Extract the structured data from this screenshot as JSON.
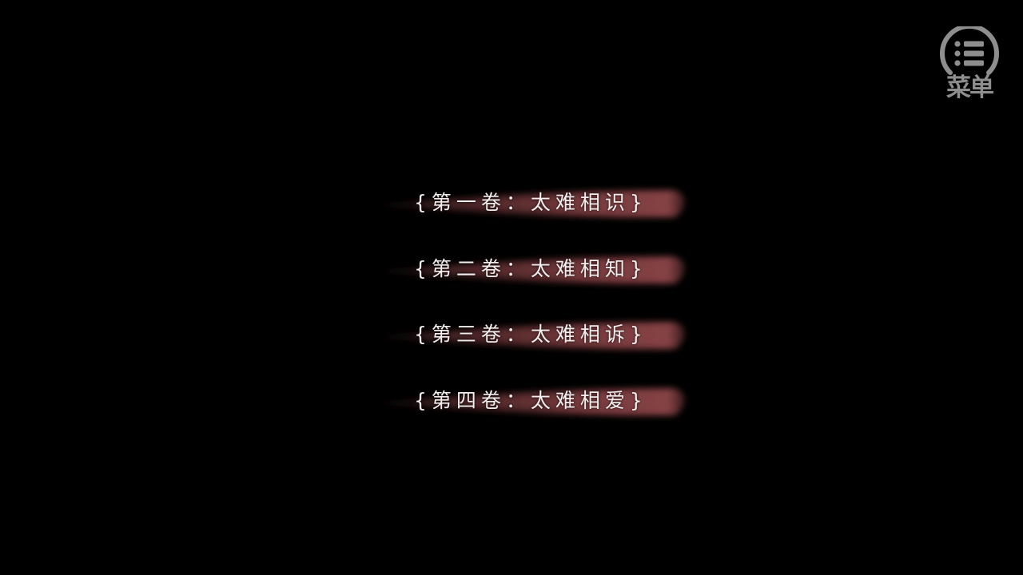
{
  "menu": {
    "label": "菜单",
    "icon": "list-menu-icon",
    "color": "#8e8e8e"
  },
  "chapters": [
    {
      "label": "{第一卷：太难相识}"
    },
    {
      "label": "{第二卷：太难相知}"
    },
    {
      "label": "{第三卷：太难相诉}"
    },
    {
      "label": "{第四卷：太难相爱}"
    }
  ],
  "colors": {
    "background": "#000000",
    "chapter_text": "#f3eeee",
    "streak": "#7a3b3e"
  }
}
